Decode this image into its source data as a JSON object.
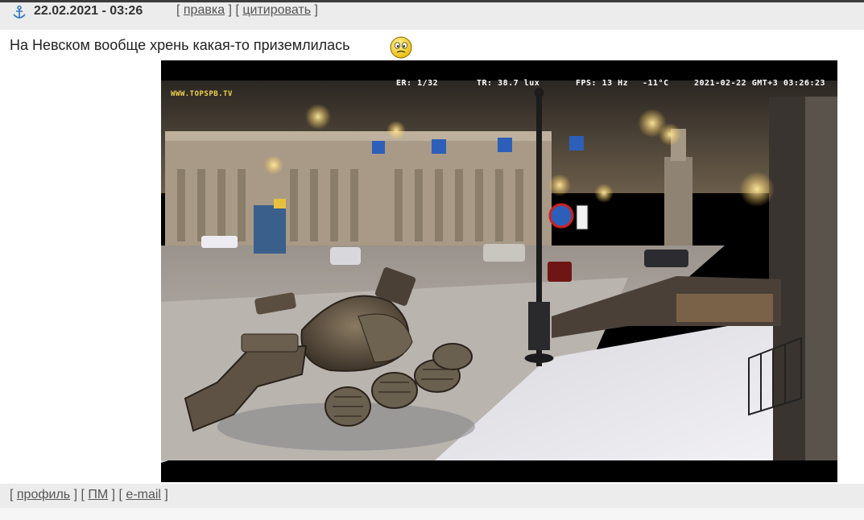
{
  "header": {
    "datetime": "22.02.2021 - 03:26",
    "links": [
      "правка",
      "цитировать"
    ]
  },
  "post": {
    "text": "На Невском вообще хрень какая-то приземлилась",
    "smiley_icon": "confused-smiley-icon"
  },
  "photo": {
    "osd_left": "ER: 1/32",
    "osd_tr": "TR: 38.7 lux",
    "osd_fps": "FPS: 13 Hz",
    "osd_temp": "-11°C",
    "osd_datetime": "2021-02-22 GMT+3 03:26:23",
    "brand": "WWW.TOPSPB.TV"
  },
  "footer": {
    "links": [
      "профиль",
      "ПМ",
      "e-mail"
    ]
  },
  "colors": {
    "bar_bg": "#ececec",
    "link": "#555555",
    "brand": "#f2d34c"
  }
}
